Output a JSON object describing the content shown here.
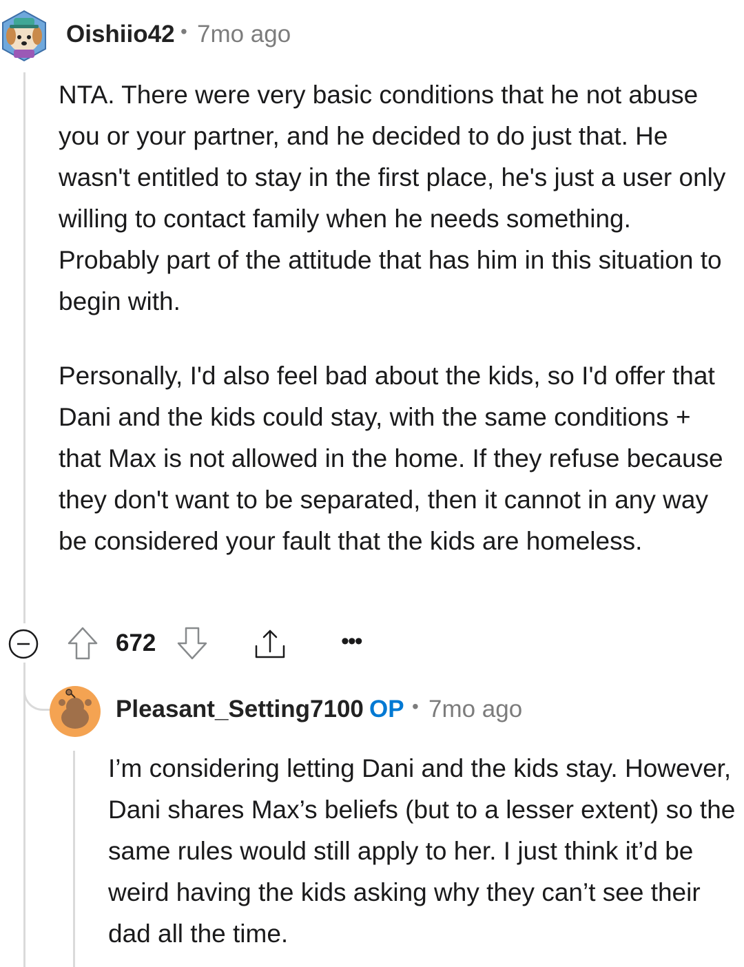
{
  "comment": {
    "username": "Oishiio42",
    "separator": "•",
    "time": "7mo ago",
    "paragraphs": [
      "NTA. There were very basic conditions that he not abuse you or your partner, and he decided to do just that. He wasn't entitled to stay in the first place, he's just a user only willing to contact family when he needs something. Probably part of the attitude that has him in this situation to begin with.",
      "Personally, I'd also feel bad about the kids, so I'd offer that Dani and the kids could stay, with the same conditions + that Max is not allowed in the home. If they refuse because they don't want to be separated, then it cannot in any way be considered your fault that the kids are homeless."
    ],
    "actions": {
      "vote_count": "672",
      "more_label": "•••"
    }
  },
  "reply": {
    "username": "Pleasant_Setting7100",
    "op_badge": "OP",
    "separator": "•",
    "time": "7mo ago",
    "paragraphs": [
      "I’m considering letting Dani and the kids stay. However, Dani shares Max’s beliefs (but to a lesser extent) so the same rules would still apply to her. I just think it’d be weird having the kids asking why they can’t see their dad all the time."
    ]
  },
  "colors": {
    "op_badge": "#0079d3",
    "meta_text": "#7c7c7c",
    "thread_line": "#dadada",
    "reply_avatar_bg": "#f4a352",
    "reply_avatar_figure": "#a0704a"
  }
}
